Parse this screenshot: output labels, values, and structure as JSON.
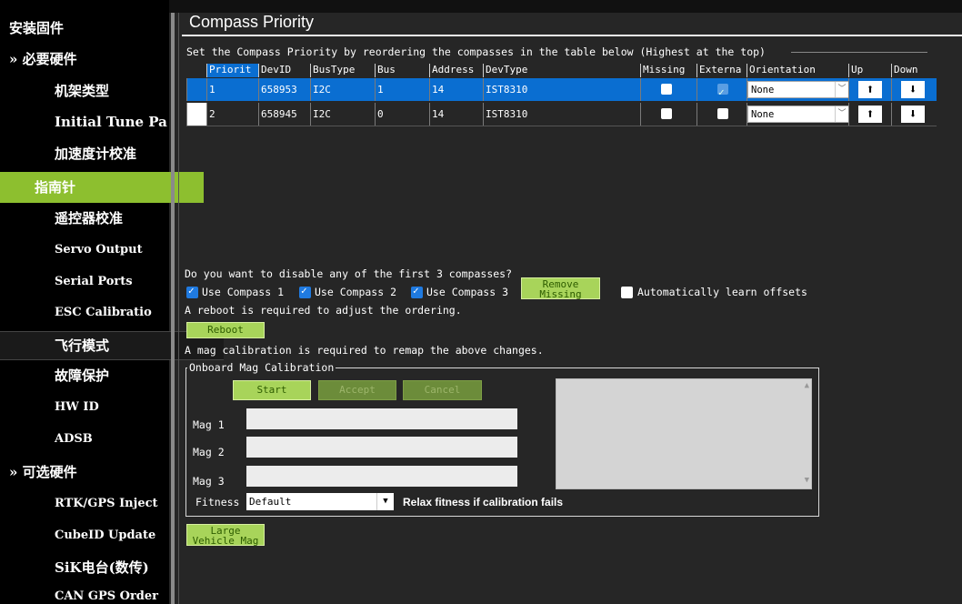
{
  "sidebar": {
    "items": [
      {
        "label": "安装固件",
        "kind": "header"
      },
      {
        "label": "» 必要硬件",
        "kind": "header"
      },
      {
        "label": "机架类型",
        "kind": "sub"
      },
      {
        "label": "Initial Tune Pa",
        "kind": "sub"
      },
      {
        "label": "加速度计校准",
        "kind": "sub"
      },
      {
        "label": "指南针",
        "kind": "active"
      },
      {
        "label": "遥控器校准",
        "kind": "sub"
      },
      {
        "label": "Servo Output",
        "kind": "sub"
      },
      {
        "label": "Serial Ports",
        "kind": "sub"
      },
      {
        "label": "ESC Calibratio",
        "kind": "sub"
      },
      {
        "label": "飞行模式",
        "kind": "sub"
      },
      {
        "label": "故障保护",
        "kind": "sub"
      },
      {
        "label": "HW ID",
        "kind": "sub"
      },
      {
        "label": "ADSB",
        "kind": "sub"
      },
      {
        "label": "» 可选硬件",
        "kind": "header"
      },
      {
        "label": "RTK/GPS Inject",
        "kind": "sub"
      },
      {
        "label": "CubeID Update",
        "kind": "sub"
      },
      {
        "label": "SiK电台(数传)",
        "kind": "sub"
      },
      {
        "label": "CAN GPS Order",
        "kind": "sub"
      }
    ]
  },
  "page": {
    "title": "Compass Priority",
    "instruction": "Set the Compass Priority by reordering the compasses in the table below (Highest at the top)"
  },
  "table": {
    "columns": [
      "Priorit",
      "DevID",
      "BusType",
      "Bus",
      "Address",
      "DevType",
      "Missing",
      "Externa",
      "Orientation",
      "Up",
      "Down"
    ],
    "rows": [
      {
        "priority": "1",
        "devid": "658953",
        "bustype": "I2C",
        "bus": "1",
        "address": "14",
        "devtype": "IST8310",
        "missing": false,
        "external": true,
        "orientation": "None",
        "selected": true
      },
      {
        "priority": "2",
        "devid": "658945",
        "bustype": "I2C",
        "bus": "0",
        "address": "14",
        "devtype": "IST8310",
        "missing": false,
        "external": false,
        "orientation": "None",
        "selected": false
      }
    ]
  },
  "disable": {
    "question": "Do you want to disable any of the first 3 compasses?",
    "compass1": "Use Compass 1",
    "compass2": "Use Compass 2",
    "compass3": "Use Compass 3",
    "remove_missing": "Remove Missing",
    "auto_learn": "Automatically learn offsets"
  },
  "reboot": {
    "note": "A reboot is required to adjust the ordering.",
    "button": "Reboot",
    "mag_note": "A mag calibration is required to remap the above changes."
  },
  "onboard": {
    "legend": "Onboard Mag Calibration",
    "start": "Start",
    "accept": "Accept",
    "cancel": "Cancel",
    "mag1": "Mag 1",
    "mag2": "Mag 2",
    "mag3": "Mag 3",
    "fitness_label": "Fitness",
    "fitness_value": "Default",
    "relax": "Relax fitness if calibration fails"
  },
  "large_vehicle": "Large Vehicle Mag",
  "icons": {
    "up": "up-arrow-icon",
    "down": "down-arrow-icon",
    "dropdown": "chevron-down-icon"
  }
}
